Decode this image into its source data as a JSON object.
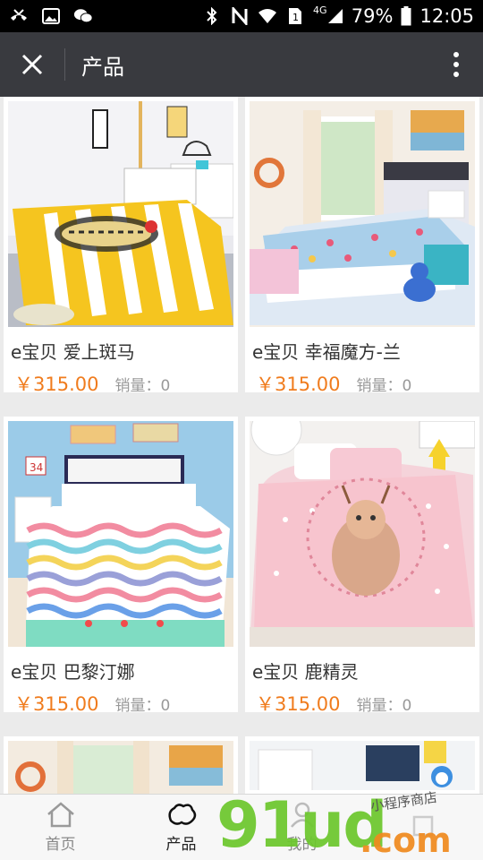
{
  "status_bar": {
    "left_icons": [
      "missed-call-icon",
      "image-icon",
      "wechat-icon"
    ],
    "right_icons": [
      "bluetooth-icon",
      "nfc-icon",
      "wifi-icon",
      "sim-icon",
      "signal-icon",
      "battery-icon"
    ],
    "network": "4G",
    "battery": "79%",
    "time": "12:05"
  },
  "header": {
    "close_icon": "close-icon",
    "title": "产品",
    "more_icon": "more-vertical-icon"
  },
  "products": [
    {
      "name": "e宝贝 爱上斑马",
      "price": "￥315.00",
      "sales": "销量：0",
      "theme": "yellow-zebra"
    },
    {
      "name": "e宝贝 幸福魔方-兰",
      "price": "￥315.00",
      "sales": "销量：0",
      "theme": "blue-floral"
    },
    {
      "name": "e宝贝 巴黎汀娜",
      "price": "￥315.00",
      "sales": "销量：0",
      "theme": "wave-stripes"
    },
    {
      "name": "e宝贝 鹿精灵",
      "price": "￥315.00",
      "sales": "销量：0",
      "theme": "pink-deer"
    },
    {
      "name": "",
      "price": "",
      "sales": "",
      "theme": "beach-room"
    },
    {
      "name": "",
      "price": "",
      "sales": "",
      "theme": "white-room"
    }
  ],
  "tabbar": {
    "tabs": [
      {
        "label": "首页",
        "icon": "home-icon",
        "active": false
      },
      {
        "label": "产品",
        "icon": "cotton-icon",
        "active": true
      },
      {
        "label": "我的",
        "icon": "user-icon",
        "active": false
      },
      {
        "label": "",
        "icon": "other-icon",
        "active": false
      }
    ]
  },
  "watermark": {
    "brand": "91ud",
    "domain": ".com",
    "cn_text": "小程序商店"
  },
  "colors": {
    "header_bg": "#393a3f",
    "price": "#f07c1e",
    "grid_bg": "#ebebeb",
    "wm_green": "#6cc72c",
    "wm_orange": "#f08a1e"
  }
}
